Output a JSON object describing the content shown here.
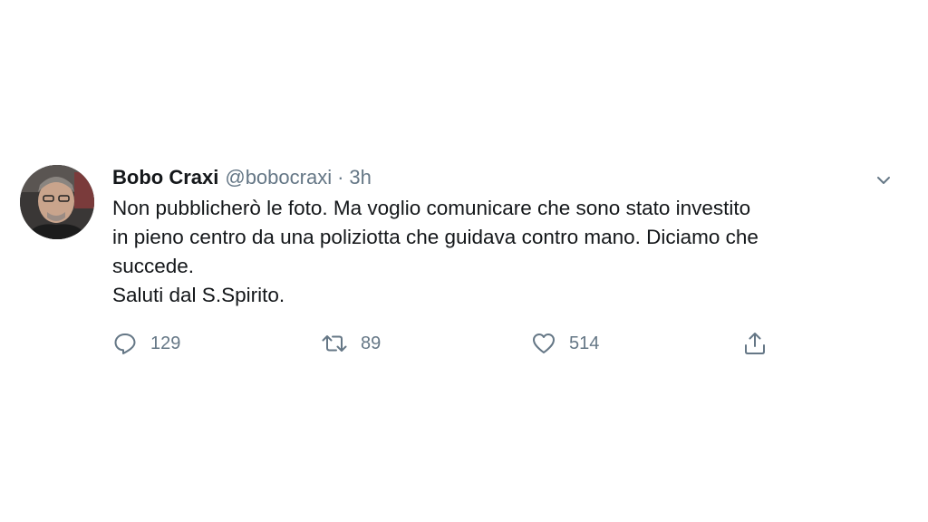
{
  "tweet": {
    "author": {
      "display_name": "Bobo Craxi",
      "handle": "@bobocraxi"
    },
    "separator": "·",
    "time": "3h",
    "text_lines": [
      "Non pubblicherò le foto. Ma voglio comunicare che sono stato investito",
      "in pieno centro da una poliziotta che guidava contro mano. Diciamo che",
      "succede.",
      "Saluti dal S.Spirito."
    ],
    "actions": {
      "reply": {
        "icon": "reply-icon",
        "count": "129"
      },
      "retweet": {
        "icon": "retweet-icon",
        "count": "89"
      },
      "like": {
        "icon": "heart-icon",
        "count": "514"
      },
      "share": {
        "icon": "share-icon"
      }
    },
    "menu_icon": "chevron-down-icon"
  },
  "colors": {
    "text_primary": "#14171a",
    "text_secondary": "#657786",
    "background": "#ffffff"
  }
}
